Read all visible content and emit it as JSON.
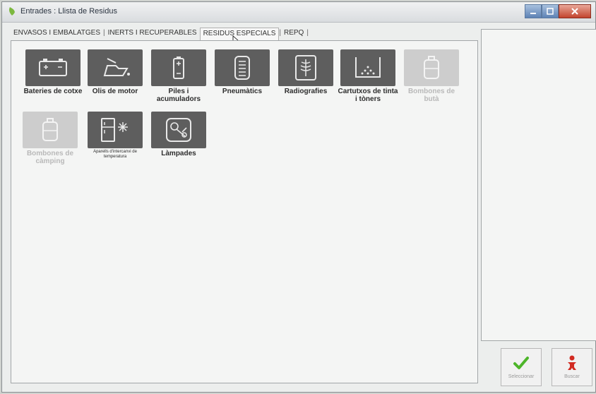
{
  "window": {
    "title": "Entrades : Llista de Residus"
  },
  "tabs": [
    {
      "label": "ENVASOS I EMBALATGES"
    },
    {
      "label": "INERTS I RECUPERABLES"
    },
    {
      "label": "RESIDUS ESPECIALS",
      "active": true
    },
    {
      "label": "REPQ"
    }
  ],
  "tiles": [
    {
      "label": "Bateries de cotxe",
      "icon": "car-battery-icon",
      "enabled": true
    },
    {
      "label": "Olis de motor",
      "icon": "oil-can-icon",
      "enabled": true
    },
    {
      "label": "Piles i acumuladors",
      "icon": "battery-cell-icon",
      "enabled": true
    },
    {
      "label": "Pneumàtics",
      "icon": "tire-icon",
      "enabled": true
    },
    {
      "label": "Radiografies",
      "icon": "xray-icon",
      "enabled": true
    },
    {
      "label": "Cartutxos de tinta i tòners",
      "icon": "ink-cartridge-icon",
      "enabled": true
    },
    {
      "label": "Bombones de butà",
      "icon": "gas-bottle-icon",
      "enabled": false
    },
    {
      "label": "Bombones de càmping",
      "icon": "camping-gas-icon",
      "enabled": false
    },
    {
      "label": "Aparells d'intercanvi de temperatura",
      "icon": "fridge-icon",
      "enabled": true
    },
    {
      "label": "Làmpades",
      "icon": "lamp-icon",
      "enabled": true
    }
  ],
  "actions": {
    "select_label": "Seleccionar",
    "search_label": "Buscar"
  },
  "colors": {
    "tile_enabled": "#5e5e5e",
    "tile_disabled": "#cdcdcd",
    "select_check": "#4db52a",
    "search_icon": "#d22b22"
  }
}
